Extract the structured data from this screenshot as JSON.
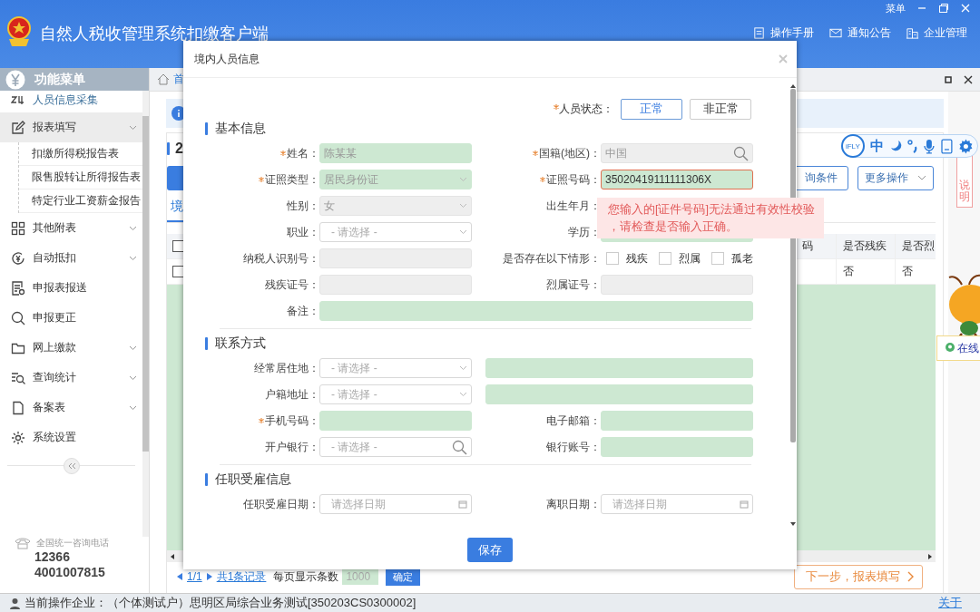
{
  "app": {
    "title": "自然人税收管理系统扣缴客户端",
    "menu": "菜单",
    "header_links": [
      "操作手册",
      "通知公告",
      "企业管理"
    ]
  },
  "sidebar": {
    "title": "功能菜单",
    "items": [
      {
        "label": "人员信息采集",
        "selected": true,
        "has_submenu": false,
        "expanded": false
      },
      {
        "label": "报表填写",
        "selected": false,
        "has_submenu": true,
        "expanded": true,
        "children": [
          {
            "label": "扣缴所得税报告表"
          },
          {
            "label": "限售股转让所得报告表"
          },
          {
            "label": "特定行业工资薪金报告"
          }
        ]
      },
      {
        "label": "其他附表",
        "selected": false,
        "has_submenu": true,
        "expanded": false
      },
      {
        "label": "自动抵扣",
        "selected": false,
        "has_submenu": true,
        "expanded": false
      },
      {
        "label": "申报表报送",
        "selected": false,
        "has_submenu": false,
        "expanded": false
      },
      {
        "label": "申报更正",
        "selected": false,
        "has_submenu": false,
        "expanded": false
      },
      {
        "label": "网上缴款",
        "selected": false,
        "has_submenu": true,
        "expanded": false
      },
      {
        "label": "查询统计",
        "selected": false,
        "has_submenu": true,
        "expanded": false
      },
      {
        "label": "备案表",
        "selected": false,
        "has_submenu": true,
        "expanded": false
      },
      {
        "label": "系统设置",
        "selected": false,
        "has_submenu": false,
        "expanded": false
      }
    ],
    "hotline": {
      "label": "全国统一咨询电话",
      "numbers": [
        "12366",
        "4001007815"
      ]
    }
  },
  "main": {
    "breadcrumb": "首",
    "heading": "2",
    "buttons": [
      "询条件",
      "更多操作"
    ],
    "tabs": [
      {
        "label": "境",
        "selected": true
      }
    ],
    "table": {
      "columns": [
        "码",
        "是否残疾",
        "是否烈"
      ],
      "header_checked": false,
      "rows": [
        {
          "checked": false,
          "cells": [
            "",
            "否",
            "否"
          ]
        }
      ]
    },
    "pager": {
      "page": "1/1",
      "total": "共1条记录",
      "size_label": "每页显示条数",
      "size": "1000",
      "confirm": "确定"
    },
    "next_button": "下一步，报表填写",
    "side_tab": "说明",
    "online_chip": "在线",
    "ifly": {
      "logo": "iFLY",
      "mode": "中"
    }
  },
  "dialog": {
    "title": "境内人员信息",
    "status": {
      "label": "人员状态：",
      "required": true,
      "options": [
        {
          "label": "正常",
          "selected": true
        },
        {
          "label": "非正常",
          "selected": false
        }
      ]
    },
    "sections": [
      {
        "title": "基本信息",
        "rows": [
          {
            "items": [
              {
                "label": "姓名：",
                "required": true,
                "kind": "text",
                "value": "陈某某",
                "highlighted": true,
                "disabled": false,
                "error": false
              },
              {
                "label": "国籍(地区)：",
                "required": true,
                "kind": "search",
                "value": "中国",
                "highlighted": false,
                "disabled": true,
                "error": false
              }
            ]
          },
          {
            "items": [
              {
                "label": "证照类型：",
                "required": true,
                "kind": "select",
                "value": "居民身份证",
                "highlighted": true,
                "disabled": false,
                "error": false
              },
              {
                "label": "证照号码：",
                "required": true,
                "kind": "text",
                "value": "35020419111111306X",
                "highlighted": true,
                "disabled": false,
                "error": true
              }
            ]
          },
          {
            "items": [
              {
                "label": "性别：",
                "required": false,
                "kind": "select",
                "value": "女",
                "highlighted": false,
                "disabled": true,
                "error": false
              },
              {
                "label": "出生年月：",
                "required": false,
                "kind": "covered"
              }
            ]
          },
          {
            "items": [
              {
                "label": "职业：",
                "required": false,
                "kind": "select",
                "placeholder": "- 请选择 -",
                "highlighted": false,
                "disabled": false,
                "error": false
              },
              {
                "label": "学历：",
                "required": false,
                "kind": "text",
                "highlighted": true,
                "disabled": false,
                "error": false
              }
            ]
          },
          {
            "items": [
              {
                "label": "纳税人识别号：",
                "required": false,
                "kind": "text",
                "highlighted": false,
                "disabled": true,
                "error": false
              },
              {
                "label": "是否存在以下情形：",
                "required": false,
                "kind": "checks",
                "options": [
                  {
                    "label": "残疾",
                    "checked": false
                  },
                  {
                    "label": "烈属",
                    "checked": false
                  },
                  {
                    "label": "孤老",
                    "checked": false
                  }
                ]
              }
            ]
          },
          {
            "items": [
              {
                "label": "残疾证号：",
                "required": false,
                "kind": "text",
                "highlighted": false,
                "disabled": true,
                "error": false
              },
              {
                "label": "烈属证号：",
                "required": false,
                "kind": "text",
                "highlighted": false,
                "disabled": true,
                "error": false
              }
            ]
          },
          {
            "items": [
              {
                "label": "备注：",
                "required": false,
                "kind": "text",
                "highlighted": true,
                "disabled": false,
                "error": false
              }
            ]
          }
        ]
      },
      {
        "title": "联系方式",
        "rows": [
          {
            "items": [
              {
                "label": "经常居住地：",
                "required": false,
                "kind": "select",
                "placeholder": "- 请选择 -",
                "highlighted": false,
                "disabled": false,
                "error": false
              },
              {
                "kind": "text",
                "highlighted": true,
                "disabled": false,
                "error": false
              }
            ]
          },
          {
            "items": [
              {
                "label": "户籍地址：",
                "required": false,
                "kind": "select",
                "placeholder": "- 请选择 -",
                "highlighted": false,
                "disabled": false,
                "error": false
              },
              {
                "kind": "text",
                "highlighted": true,
                "disabled": false,
                "error": false
              }
            ]
          },
          {
            "items": [
              {
                "label": "手机号码：",
                "required": true,
                "kind": "text",
                "highlighted": true,
                "disabled": false,
                "error": false
              },
              {
                "label": "电子邮箱：",
                "required": false,
                "kind": "text",
                "highlighted": true,
                "disabled": false,
                "error": false
              }
            ]
          },
          {
            "items": [
              {
                "label": "开户银行：",
                "required": false,
                "kind": "search",
                "placeholder": "- 请选择 -",
                "highlighted": false,
                "disabled": false,
                "error": false
              },
              {
                "label": "银行账号：",
                "required": false,
                "kind": "text",
                "highlighted": true,
                "disabled": false,
                "error": false
              }
            ]
          }
        ]
      },
      {
        "title": "任职受雇信息",
        "rows": [
          {
            "items": [
              {
                "label": "任职受雇日期：",
                "required": false,
                "kind": "date",
                "placeholder": "请选择日期",
                "highlighted": false,
                "disabled": false,
                "error": false
              },
              {
                "label": "离职日期：",
                "required": false,
                "kind": "date",
                "placeholder": "请选择日期",
                "highlighted": false,
                "disabled": false,
                "error": false
              }
            ]
          }
        ]
      }
    ],
    "error_tip": {
      "lines": [
        "您输入的[证件号码]无法通过有效性校验",
        "，请检查是否输入正确。"
      ]
    },
    "save_button": "保存"
  },
  "status_bar": {
    "company": "当前操作企业：（个体测试户）思明区局综合业务测试[350203CS0300002]",
    "about": "关于"
  }
}
